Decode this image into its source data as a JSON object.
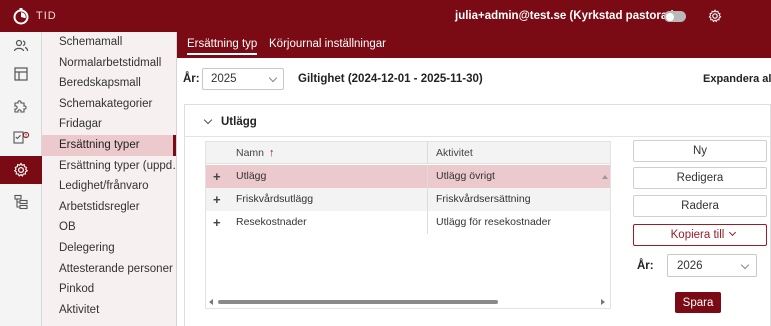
{
  "topbar": {
    "app_name": "TID",
    "user": "julia+admin@test.se (Kyrkstad pastorat)",
    "accent": "#7a0a14"
  },
  "rail": {
    "items": [
      {
        "icon": "users-icon"
      },
      {
        "icon": "layout-icon"
      },
      {
        "icon": "puzzle-icon"
      },
      {
        "icon": "checklist-alert-icon"
      },
      {
        "icon": "gear-icon",
        "active": true
      },
      {
        "icon": "hierarchy-icon"
      }
    ]
  },
  "submenu": {
    "items": [
      {
        "label": "Schemamall"
      },
      {
        "label": "Normalarbetstidmall"
      },
      {
        "label": "Beredskapsmall"
      },
      {
        "label": "Schemakategorier"
      },
      {
        "label": "Fridagar"
      },
      {
        "label": "Ersättning typer",
        "active": true
      },
      {
        "label": "Ersättning typer (uppd…"
      },
      {
        "label": "Ledighet/frånvaro"
      },
      {
        "label": "Arbetstidsregler"
      },
      {
        "label": "OB"
      },
      {
        "label": "Delegering"
      },
      {
        "label": "Attesterande personer"
      },
      {
        "label": "Pinkod"
      },
      {
        "label": "Aktivitet"
      }
    ]
  },
  "tabs": [
    {
      "label": "Ersättning typ",
      "active": true
    },
    {
      "label": "Körjournal inställningar"
    }
  ],
  "filter": {
    "year_label": "År:",
    "year_value": "2025",
    "validity": "Giltighet (2024-12-01 - 2025-11-30)",
    "expand_label": "Expandera alla"
  },
  "panel": {
    "title": "Utlägg",
    "columns": [
      "Namn",
      "Aktivitet"
    ],
    "sort_indicator": "↑",
    "rows": [
      {
        "name": "Utlägg",
        "activity": "Utlägg övrigt",
        "selected": true
      },
      {
        "name": "Friskvårdsutlägg",
        "activity": "Friskvårdsersättning"
      },
      {
        "name": "Resekostnader",
        "activity": "Utlägg för resekostnader"
      }
    ]
  },
  "actions": {
    "new": "Ny",
    "edit": "Redigera",
    "delete": "Radera",
    "copy_to": "Kopiera till",
    "year_label": "År:",
    "year_value": "2026",
    "save": "Spara"
  }
}
